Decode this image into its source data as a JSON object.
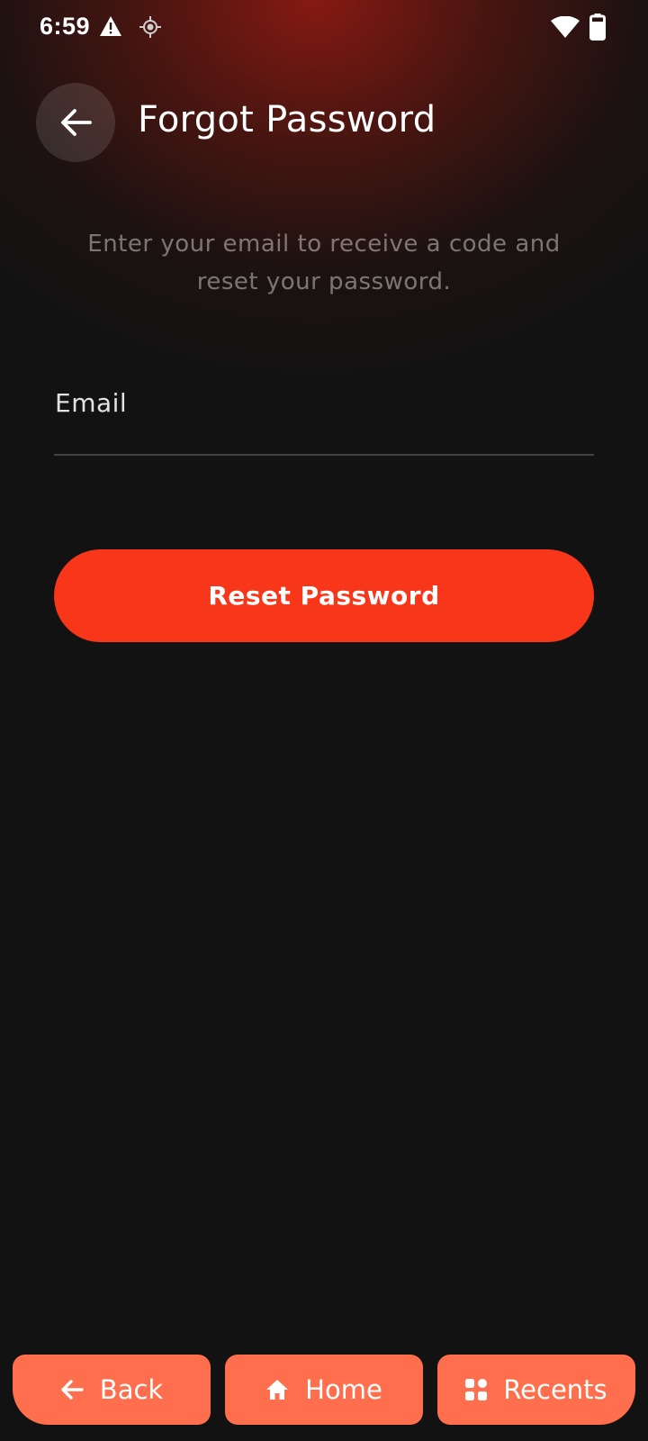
{
  "status_bar": {
    "time": "6:59",
    "left_icons": [
      "warning-icon",
      "location-target-icon"
    ],
    "right_icons": [
      "wifi-icon",
      "battery-icon"
    ]
  },
  "header": {
    "back_icon": "arrow-left-icon",
    "title": "Forgot Password"
  },
  "subtitle": "Enter your email to receive a code and reset your password.",
  "form": {
    "email_label": "Email",
    "email_value": "",
    "submit_label": "Reset Password"
  },
  "colors": {
    "background": "#121212",
    "accent": "#f8361a",
    "nav_button": "#ff6f4d",
    "glow": "#8c1a12"
  },
  "nav_bar": {
    "back": {
      "label": "Back",
      "icon": "arrow-left-icon"
    },
    "home": {
      "label": "Home",
      "icon": "home-icon"
    },
    "recents": {
      "label": "Recents",
      "icon": "grid-icon"
    }
  }
}
